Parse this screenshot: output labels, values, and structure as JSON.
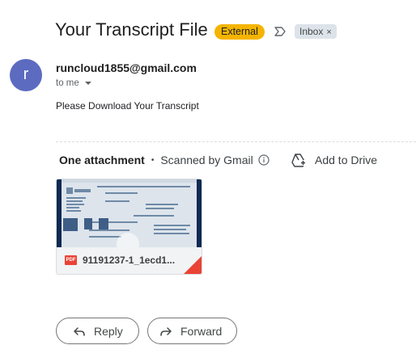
{
  "subject": "Your Transcript File",
  "badges": {
    "external": "External",
    "inbox": "Inbox",
    "inbox_remove": "×"
  },
  "sender": {
    "avatar_letter": "r",
    "email": "runcloud1855@gmail.com",
    "to": "to me"
  },
  "body": {
    "text": "Please Download Your Transcript"
  },
  "attachments": {
    "title": "One attachment",
    "separator": "•",
    "scan_text": "Scanned by Gmail",
    "add_to_drive": "Add to Drive",
    "file": {
      "type_badge": "PDF",
      "name": "91191237-1_1ecd1..."
    }
  },
  "actions": {
    "reply": "Reply",
    "forward": "Forward"
  },
  "colors": {
    "external_badge": "#f4b400",
    "avatar": "#5c6bc0",
    "pdf": "#ea4335"
  }
}
